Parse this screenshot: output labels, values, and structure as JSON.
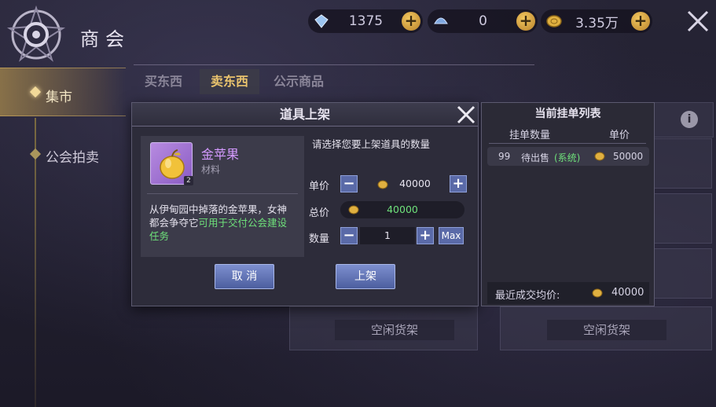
{
  "header": {
    "title": "商会",
    "resources": [
      {
        "icon": "gem-icon",
        "value": "1375"
      },
      {
        "icon": "shell-icon",
        "value": "0"
      },
      {
        "icon": "gold-coin-icon",
        "value": "3.35万"
      }
    ]
  },
  "sidebar": {
    "items": [
      {
        "label": "集市",
        "active": true
      },
      {
        "label": "公会拍卖",
        "active": false
      }
    ]
  },
  "tabs": [
    {
      "label": "买东西",
      "active": false
    },
    {
      "label": "卖东西",
      "active": true
    },
    {
      "label": "公示商品",
      "active": false
    }
  ],
  "shelves": {
    "empty_label_1": "空闲货架",
    "empty_label_2": "空闲货架"
  },
  "dialog": {
    "title": "道具上架",
    "item": {
      "name": "金苹果",
      "type": "材料",
      "count": "2",
      "desc_plain": "从伊甸园中掉落的金苹果，女神都会争夺它",
      "desc_highlight": "可用于交付公会建设任务"
    },
    "prompt": "请选择您要上架道具的数量",
    "unit_price_label": "单价",
    "unit_price": "40000",
    "total_label": "总价",
    "total": "40000",
    "qty_label": "数量",
    "qty": "1",
    "max_label": "Max",
    "cancel_label": "取 消",
    "confirm_label": "上架"
  },
  "listing": {
    "title": "当前挂单列表",
    "col_qty": "挂单数量",
    "col_price": "单价",
    "rows": [
      {
        "qty": "99",
        "status": "待出售",
        "tag": "(系统)",
        "price": "50000"
      }
    ],
    "recent_label": "最近成交均价:",
    "recent_price": "40000"
  },
  "colors": {
    "accent_gold": "#e9c36d",
    "item_purple": "#d49aff",
    "highlight_green": "#6ee07a",
    "button_blue": "#5a6aa8"
  }
}
